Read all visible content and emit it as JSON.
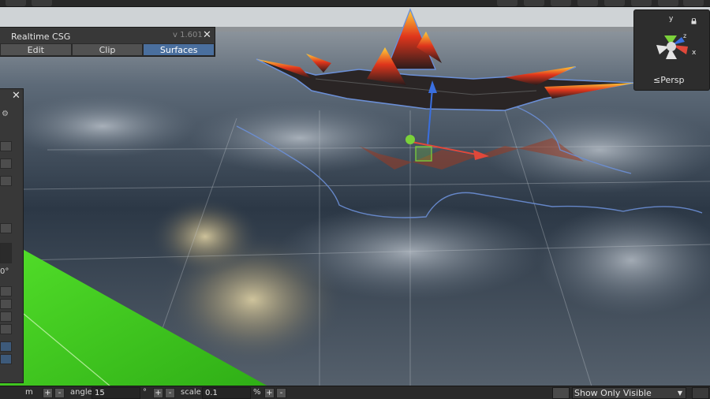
{
  "csg_panel": {
    "title": "Realtime CSG",
    "version": "v 1.601",
    "close_glyph": "✕",
    "tabs": [
      {
        "label": "Edit",
        "active": false
      },
      {
        "label": "Clip",
        "active": false
      },
      {
        "label": "Surfaces",
        "active": true
      }
    ]
  },
  "side_panel": {
    "close_glyph": "✕",
    "gear_glyph": "⚙",
    "degree_text": "0°"
  },
  "gizmo": {
    "projection_label": "≤Persp",
    "axis_x": "x",
    "axis_y": "y",
    "axis_z": "z",
    "lock_glyph": "🔒"
  },
  "statusbar": {
    "unit_label": "m",
    "angle_label": "angle",
    "angle_value": "15",
    "degree_symbol": "°",
    "scale_label": "scale",
    "scale_value": "0.1",
    "percent_symbol": "%",
    "plus": "+",
    "minus": "-",
    "visibility_option": "Show Only Visible",
    "dropdown_arrow": "▼"
  },
  "colors": {
    "accent_tab": "#4a6f9e",
    "axis_x": "#e0483a",
    "axis_y": "#7bd13a",
    "axis_z": "#3a6fe0",
    "ground_green": "#3ec21e"
  }
}
